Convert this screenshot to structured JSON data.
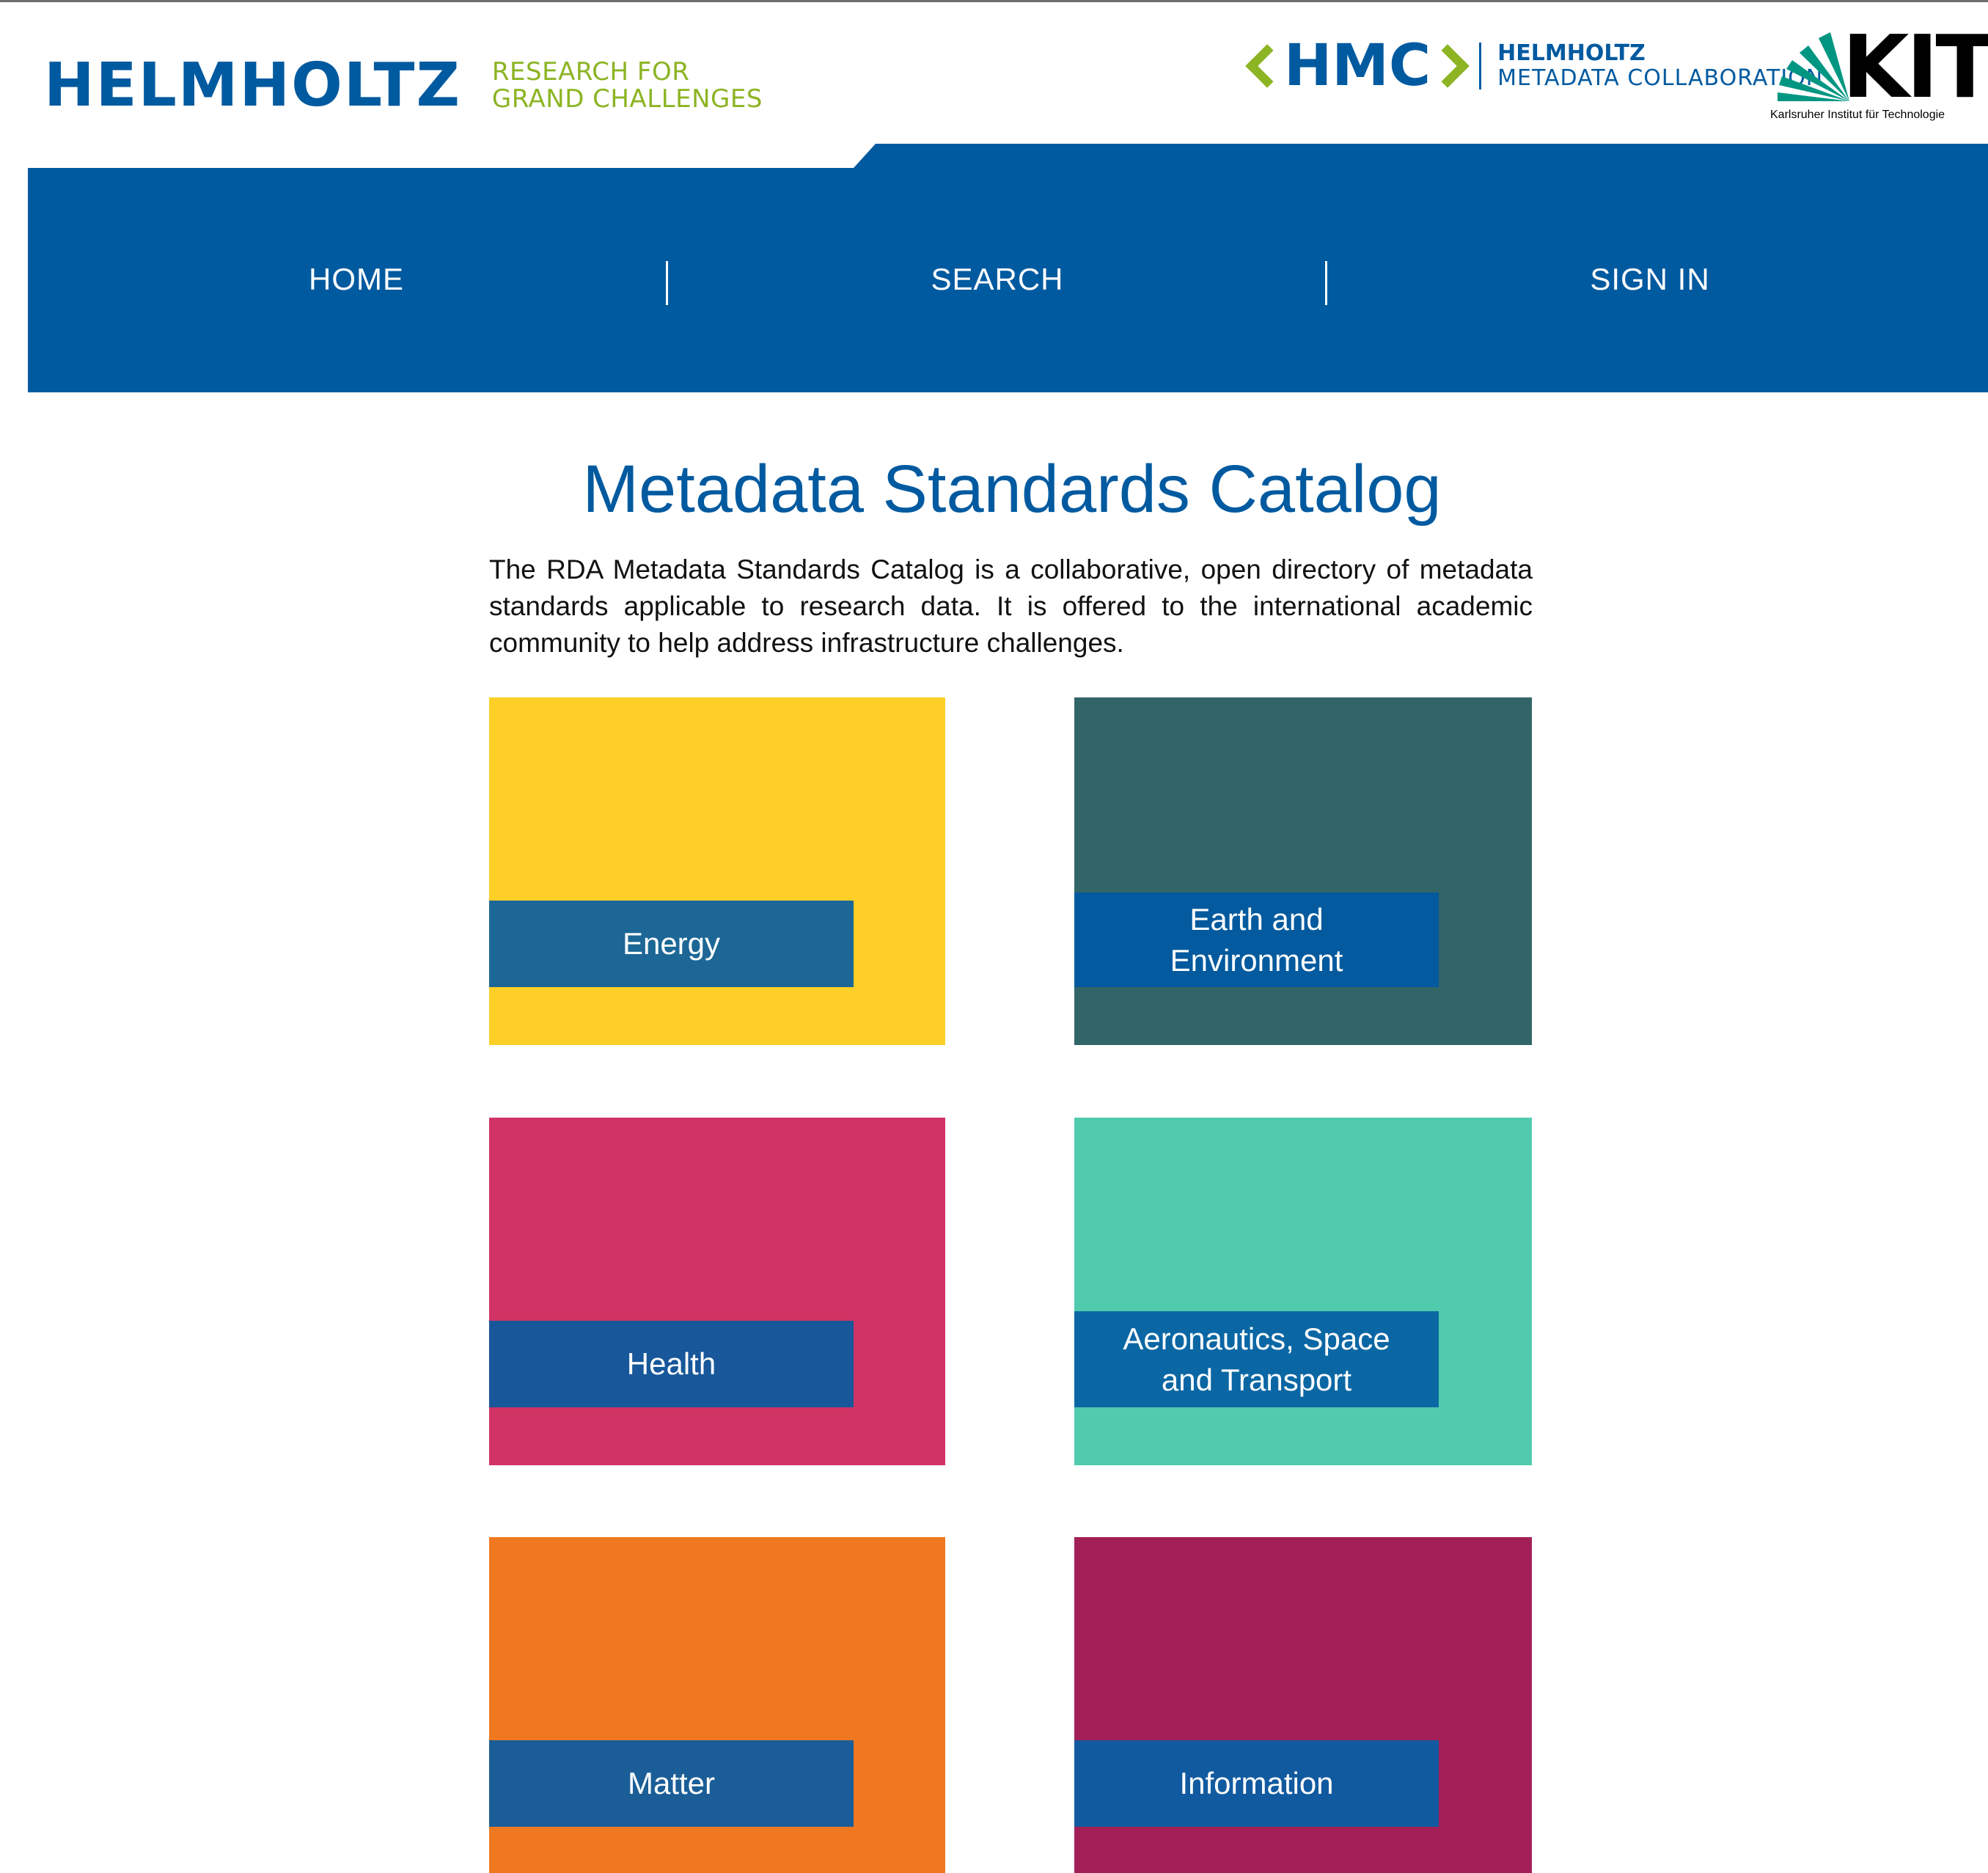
{
  "header": {
    "helmholtz_logo": {
      "word": "HELMHOLTZ",
      "tagline_line1": "RESEARCH FOR",
      "tagline_line2": "GRAND CHALLENGES"
    },
    "hmc_logo": {
      "acronym": "HMC",
      "name_line1": "HELMHOLTZ",
      "name_line2": "METADATA COLLABORATION"
    },
    "kit_logo": {
      "acronym": "KIT",
      "full_name": "Karlsruher Institut für Technologie"
    }
  },
  "nav": {
    "items": [
      {
        "label": "HOME"
      },
      {
        "label": "SEARCH"
      },
      {
        "label": "SIGN IN"
      }
    ]
  },
  "main": {
    "title": "Metadata Standards Catalog",
    "intro": "The RDA Metadata Standards Catalog is a collaborative, open directory of metadata standards applicable to research data. It is offered to the international academic community to help address infrastructure challenges."
  },
  "tiles": [
    {
      "label": "Energy",
      "lines": [
        "Energy"
      ],
      "color": "#fdcf27",
      "label_color": "#1c6796"
    },
    {
      "label": "Earth and Environment",
      "lines": [
        "Earth and",
        "Environment"
      ],
      "color": "#326568",
      "label_color": "#035a9e"
    },
    {
      "label": "Health",
      "lines": [
        "Health"
      ],
      "color": "#d23365",
      "label_color": "#17579a"
    },
    {
      "label": "Aeronautics, Space and Transport",
      "lines": [
        "Aeronautics, Space",
        "and Transport"
      ],
      "color": "#50cbad",
      "label_color": "#0b67a4"
    },
    {
      "label": "Matter",
      "lines": [
        "Matter"
      ],
      "color": "#f07821",
      "label_color": "#1b5e97"
    },
    {
      "label": "Information",
      "lines": [
        "Information"
      ],
      "color": "#a22057",
      "label_color": "#125a9f"
    }
  ],
  "colors": {
    "brand_blue": "#005aa0",
    "brand_green": "#8cb423",
    "nav_background": "#005aa0",
    "kit_green": "#009682"
  }
}
